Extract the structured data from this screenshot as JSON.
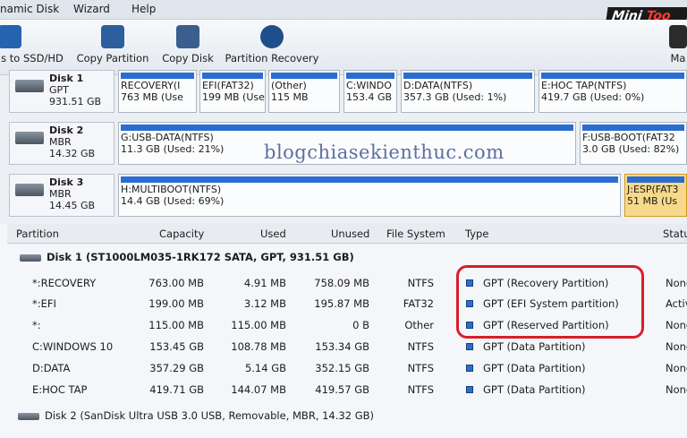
{
  "menu": [
    "namic Disk",
    "Wizard",
    "Help"
  ],
  "brand": {
    "part1": "Mini",
    "part2": " Too"
  },
  "toolbar": [
    {
      "label": "s to SSD/HD",
      "icon": "migrate-icon"
    },
    {
      "label": "Copy Partition",
      "icon": "copy-partition-icon"
    },
    {
      "label": "Copy Disk",
      "icon": "copy-disk-icon"
    },
    {
      "label": "Partition Recovery",
      "icon": "partition-recovery-icon"
    },
    {
      "label": "Ma",
      "icon": "manual-icon"
    }
  ],
  "watermark": "blogchiasekienthuc.com",
  "disks": [
    {
      "name": "Disk 1",
      "type": "GPT",
      "size": "931.51 GB",
      "parts": [
        {
          "l1": "RECOVERY(I",
          "l2": "763 MB (Use"
        },
        {
          "l1": "EFI(FAT32)",
          "l2": "199 MB (Use"
        },
        {
          "l1": "(Other)",
          "l2": "115 MB"
        },
        {
          "l1": "C:WINDO",
          "l2": "153.4 GB"
        },
        {
          "l1": "D:DATA(NTFS)",
          "l2": "357.3 GB (Used: 1%)"
        },
        {
          "l1": "E:HOC TAP(NTFS)",
          "l2": "419.7 GB (Used: 0%)"
        }
      ]
    },
    {
      "name": "Disk 2",
      "type": "MBR",
      "size": "14.32 GB",
      "parts": [
        {
          "l1": "G:USB-DATA(NTFS)",
          "l2": "11.3 GB (Used: 21%)"
        },
        {
          "l1": "F:USB-BOOT(FAT32",
          "l2": "3.0 GB (Used: 82%)"
        }
      ]
    },
    {
      "name": "Disk 3",
      "type": "MBR",
      "size": "14.45 GB",
      "parts": [
        {
          "l1": "H:MULTIBOOT(NTFS)",
          "l2": "14.4 GB (Used: 69%)"
        },
        {
          "l1": "J:ESP(FAT3",
          "l2": "51 MB (Us"
        }
      ]
    }
  ],
  "table": {
    "headers": [
      "Partition",
      "Capacity",
      "Used",
      "Unused",
      "File System",
      "Type",
      "Statu"
    ],
    "disk1_label": "Disk 1 (ST1000LM035-1RK172 SATA, GPT, 931.51 GB)",
    "rows": [
      {
        "partition": "*:RECOVERY",
        "capacity": "763.00 MB",
        "used": "4.91 MB",
        "unused": "758.09 MB",
        "fs": "NTFS",
        "type": "GPT (Recovery Partition)",
        "status": "None"
      },
      {
        "partition": "*:EFI",
        "capacity": "199.00 MB",
        "used": "3.12 MB",
        "unused": "195.87 MB",
        "fs": "FAT32",
        "type": "GPT (EFI System partition)",
        "status": "Activ"
      },
      {
        "partition": "*:",
        "capacity": "115.00 MB",
        "used": "115.00 MB",
        "unused": "0 B",
        "fs": "Other",
        "type": "GPT (Reserved Partition)",
        "status": "None"
      },
      {
        "partition": "C:WINDOWS 10",
        "capacity": "153.45 GB",
        "used": "108.78 MB",
        "unused": "153.34 GB",
        "fs": "NTFS",
        "type": "GPT (Data Partition)",
        "status": "None"
      },
      {
        "partition": "D:DATA",
        "capacity": "357.29 GB",
        "used": "5.14 GB",
        "unused": "352.15 GB",
        "fs": "NTFS",
        "type": "GPT (Data Partition)",
        "status": "None"
      },
      {
        "partition": "E:HOC TAP",
        "capacity": "419.71 GB",
        "used": "144.07 MB",
        "unused": "419.57 GB",
        "fs": "NTFS",
        "type": "GPT (Data Partition)",
        "status": "None"
      }
    ],
    "disk2_label": "Disk 2 (SanDisk Ultra USB 3.0 USB, Removable, MBR, 14.32 GB)"
  },
  "colors": {
    "bar": "#2b6cd1",
    "highlight": "#d71f26",
    "selected": "#f6d98a"
  }
}
